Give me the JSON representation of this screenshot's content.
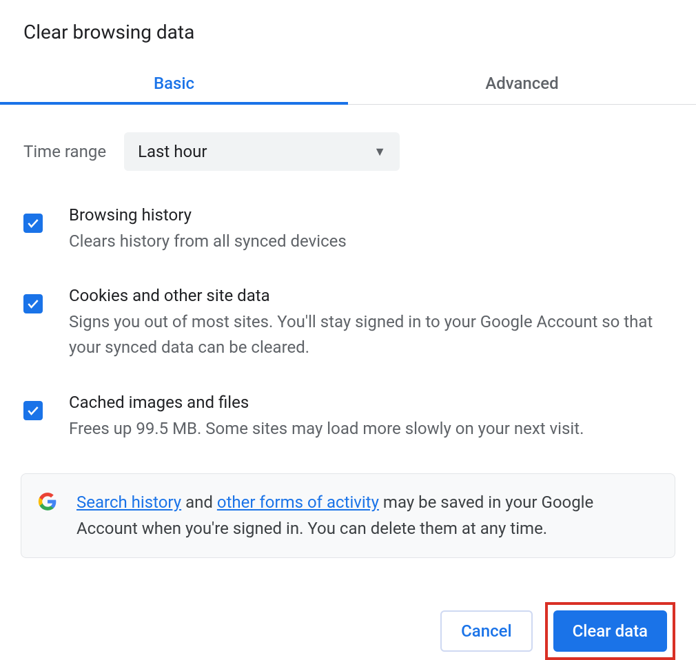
{
  "dialog": {
    "title": "Clear browsing data"
  },
  "tabs": {
    "basic": "Basic",
    "advanced": "Advanced"
  },
  "timeRange": {
    "label": "Time range",
    "selected": "Last hour"
  },
  "options": {
    "history": {
      "title": "Browsing history",
      "desc": "Clears history from all synced devices",
      "checked": true
    },
    "cookies": {
      "title": "Cookies and other site data",
      "desc": "Signs you out of most sites. You'll stay signed in to your Google Account so that your synced data can be cleared.",
      "checked": true
    },
    "cache": {
      "title": "Cached images and files",
      "desc": "Frees up 99.5 MB. Some sites may load more slowly on your next visit.",
      "checked": true
    }
  },
  "infoBox": {
    "link1": "Search history",
    "middle1": " and ",
    "link2": "other forms of activity",
    "trail": " may be saved in your Google Account when you're signed in. You can delete them at any time."
  },
  "footer": {
    "cancel": "Cancel",
    "clear": "Clear data"
  }
}
